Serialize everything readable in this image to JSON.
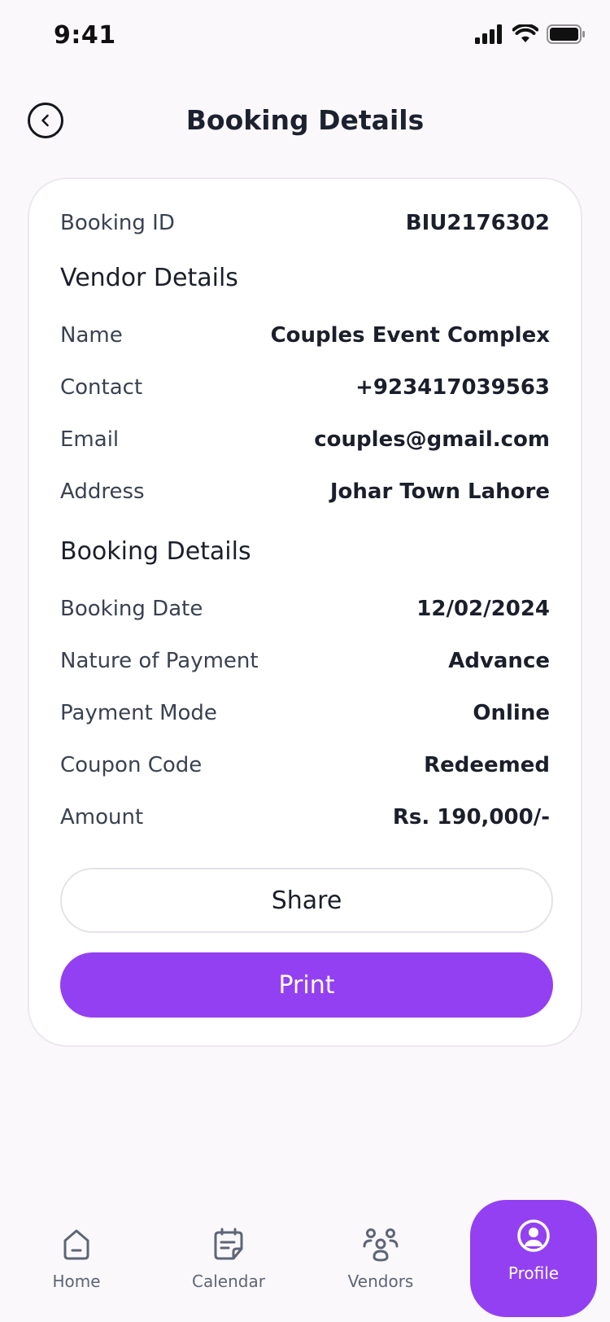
{
  "status_bar": {
    "time": "9:41"
  },
  "header": {
    "title": "Booking Details"
  },
  "booking": {
    "id_label": "Booking ID",
    "id_value": "BIU2176302"
  },
  "vendor": {
    "section_title": "Vendor Details",
    "rows": [
      {
        "label": "Name",
        "value": "Couples Event Complex"
      },
      {
        "label": "Contact",
        "value": "+923417039563"
      },
      {
        "label": "Email",
        "value": "couples@gmail.com"
      },
      {
        "label": "Address",
        "value": "Johar Town Lahore"
      }
    ]
  },
  "details": {
    "section_title": "Booking Details",
    "rows": [
      {
        "label": "Booking Date",
        "value": "12/02/2024"
      },
      {
        "label": "Nature of Payment",
        "value": "Advance"
      },
      {
        "label": "Payment Mode",
        "value": "Online"
      },
      {
        "label": "Coupon Code",
        "value": "Redeemed"
      },
      {
        "label": "Amount",
        "value": "Rs. 190,000/-"
      }
    ]
  },
  "actions": {
    "share_label": "Share",
    "print_label": "Print"
  },
  "nav": {
    "items": [
      {
        "label": "Home",
        "icon": "home-icon"
      },
      {
        "label": "Calendar",
        "icon": "calendar-icon"
      },
      {
        "label": "Vendors",
        "icon": "vendors-icon"
      },
      {
        "label": "Profile",
        "icon": "profile-icon",
        "active": true
      }
    ]
  },
  "colors": {
    "accent": "#9340f2",
    "background": "#fbf8fb",
    "card": "#ffffff",
    "text_primary": "#1b1f2b",
    "text_secondary": "#3a4152"
  }
}
